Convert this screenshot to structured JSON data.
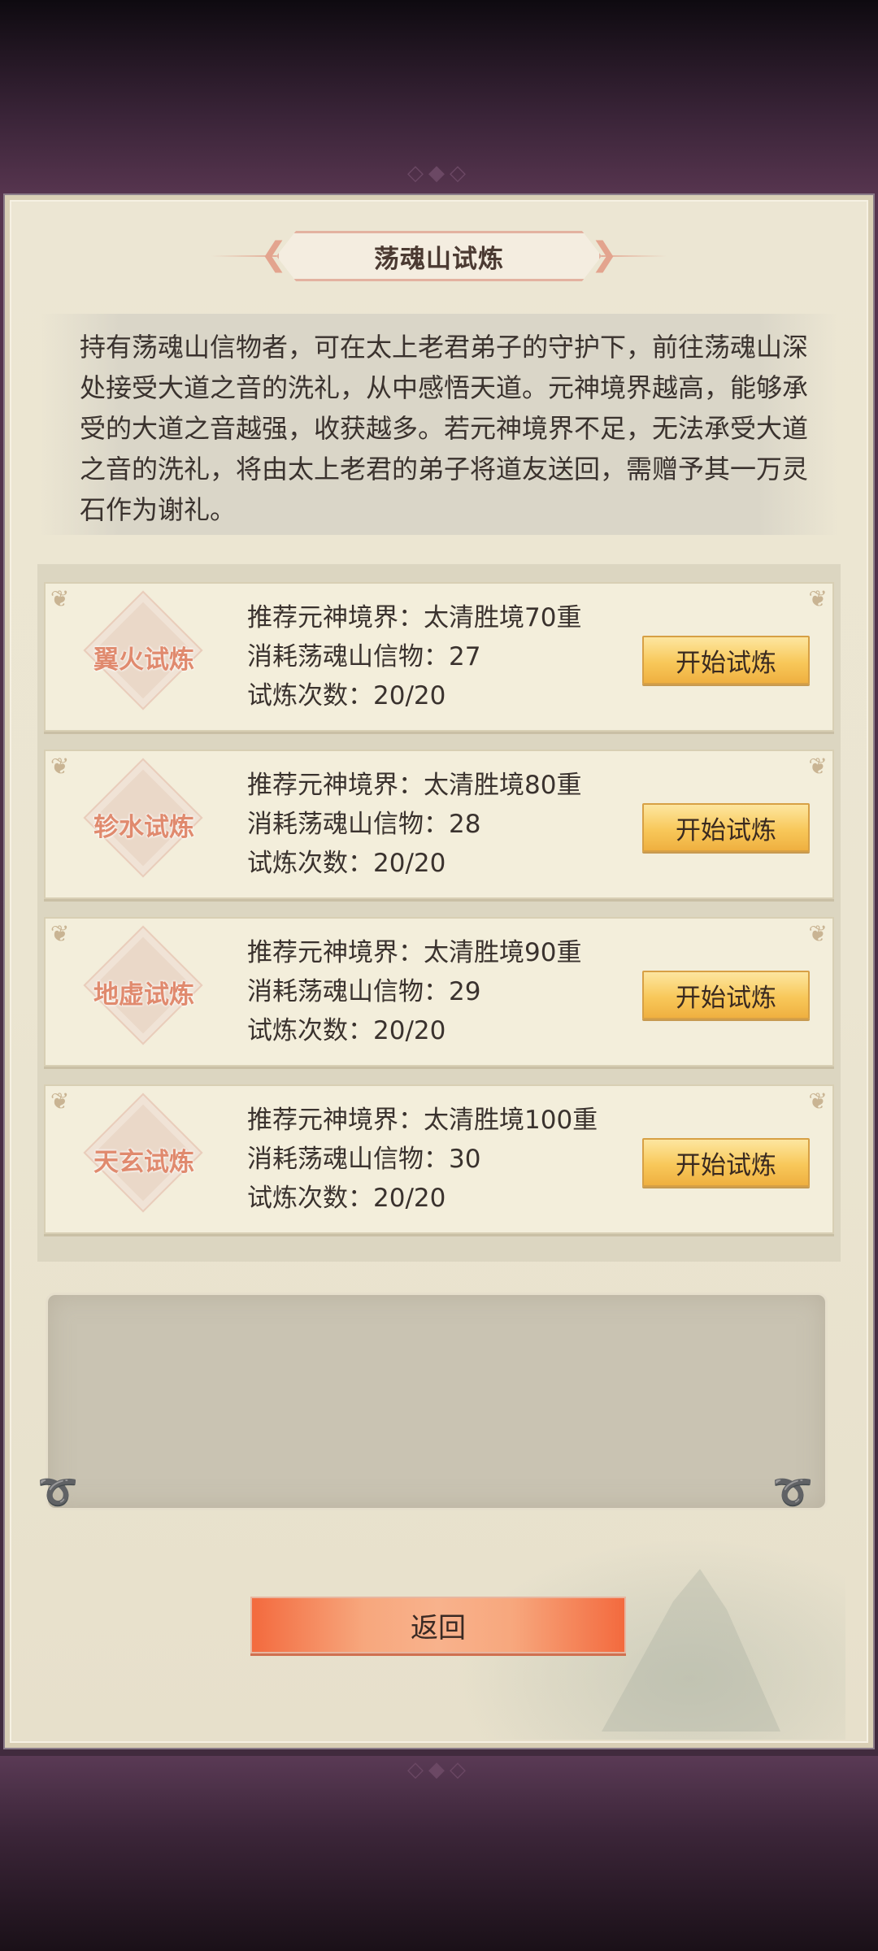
{
  "title": "荡魂山试炼",
  "description": "持有荡魂山信物者，可在太上老君弟子的守护下，前往荡魂山深处接受大道之音的洗礼，从中感悟天道。元神境界越高，能够承受的大道之音越强，收获越多。若元神境界不足，无法承受大道之音的洗礼，将由太上老君的弟子将道友送回，需赠予其一万灵石作为谢礼。",
  "trials": [
    {
      "name": "翼火试炼",
      "recommend": "推荐元神境界：太清胜境70重",
      "cost": "消耗荡魂山信物：27",
      "count": "试炼次数：20/20",
      "button": "开始试炼"
    },
    {
      "name": "轸水试炼",
      "recommend": "推荐元神境界：太清胜境80重",
      "cost": "消耗荡魂山信物：28",
      "count": "试炼次数：20/20",
      "button": "开始试炼"
    },
    {
      "name": "地虚试炼",
      "recommend": "推荐元神境界：太清胜境90重",
      "cost": "消耗荡魂山信物：29",
      "count": "试炼次数：20/20",
      "button": "开始试炼"
    },
    {
      "name": "天玄试炼",
      "recommend": "推荐元神境界：太清胜境100重",
      "cost": "消耗荡魂山信物：30",
      "count": "试炼次数：20/20",
      "button": "开始试炼"
    }
  ],
  "back_label": "返回",
  "colors": {
    "start_button": "#f8c85a",
    "back_button": "#f36a3e",
    "trial_name": "#e08a6e"
  }
}
